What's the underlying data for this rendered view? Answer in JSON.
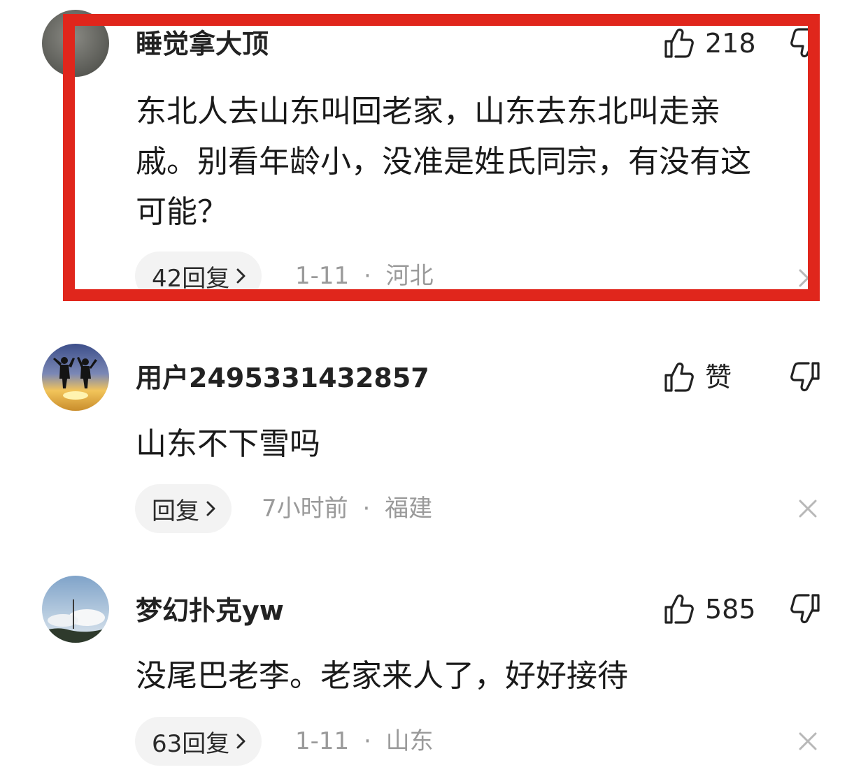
{
  "comments": [
    {
      "username": "睡觉拿大顶",
      "avatar_icon": "avatar-gray-icon",
      "like_count": "218",
      "text_lines": [
        "东北人去山东叫回老家，山东去东北叫走亲",
        "戚。别看年龄小，没准是姓氏同宗，有没有这",
        "可能？"
      ],
      "reply_label": "42回复",
      "date": "1-11",
      "location": "河北",
      "highlighted": true
    },
    {
      "username": "用户2495331432857",
      "avatar_icon": "avatar-sunset-jump-icon",
      "like_count": "赞",
      "text_lines": [
        "山东不下雪吗"
      ],
      "reply_label": "回复",
      "date": "7小时前",
      "location": "福建"
    },
    {
      "username": "梦幻扑克yw",
      "avatar_icon": "avatar-sky-tower-icon",
      "like_count": "585",
      "text_lines": [
        "没尾巴老李。老家来人了，好好接待"
      ],
      "reply_label": "63回复",
      "date": "1-11",
      "location": "山东"
    }
  ],
  "meta_separator": "·",
  "colors": {
    "highlight_border": "#e0261c",
    "meta_text": "#9a9a9a",
    "pill_bg": "#f3f3f3"
  }
}
